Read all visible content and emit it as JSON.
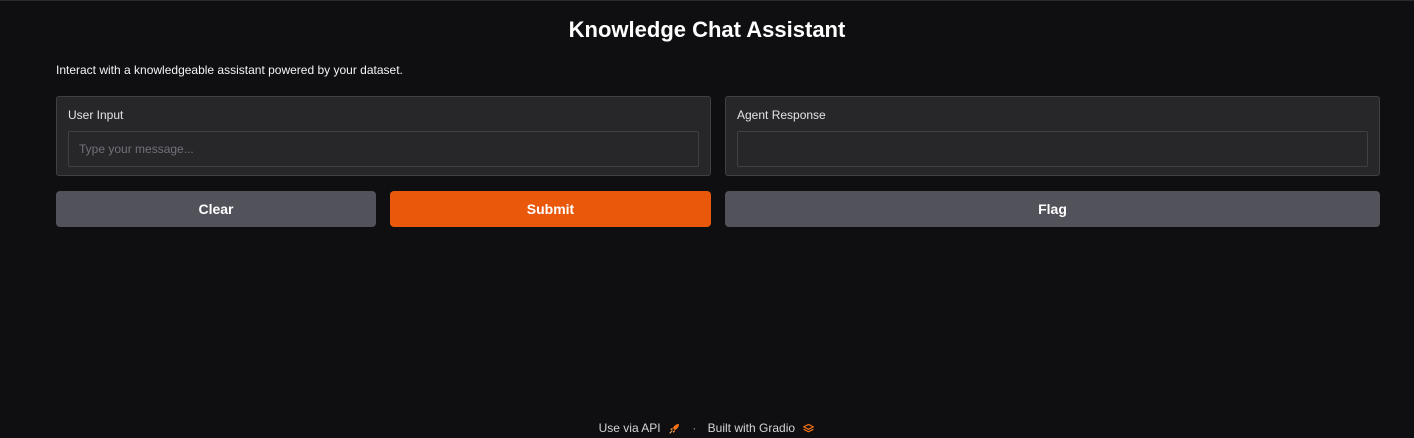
{
  "app": {
    "title": "Knowledge Chat Assistant",
    "description": "Interact with a knowledgeable assistant powered by your dataset."
  },
  "inputs": {
    "user_input": {
      "label": "User Input",
      "value": "",
      "placeholder": "Type your message..."
    },
    "agent_response": {
      "label": "Agent Response",
      "value": ""
    }
  },
  "buttons": {
    "clear": "Clear",
    "submit": "Submit",
    "flag": "Flag"
  },
  "footer": {
    "api_link": "Use via API",
    "api_icon": "rocket-icon",
    "separator": "·",
    "built_with": "Built with Gradio",
    "gradio_icon": "gradio-logo-icon"
  },
  "colors": {
    "background": "#0f0f11",
    "panel": "#27272a",
    "primary_accent": "#ea580c",
    "secondary_button": "#52525b"
  }
}
